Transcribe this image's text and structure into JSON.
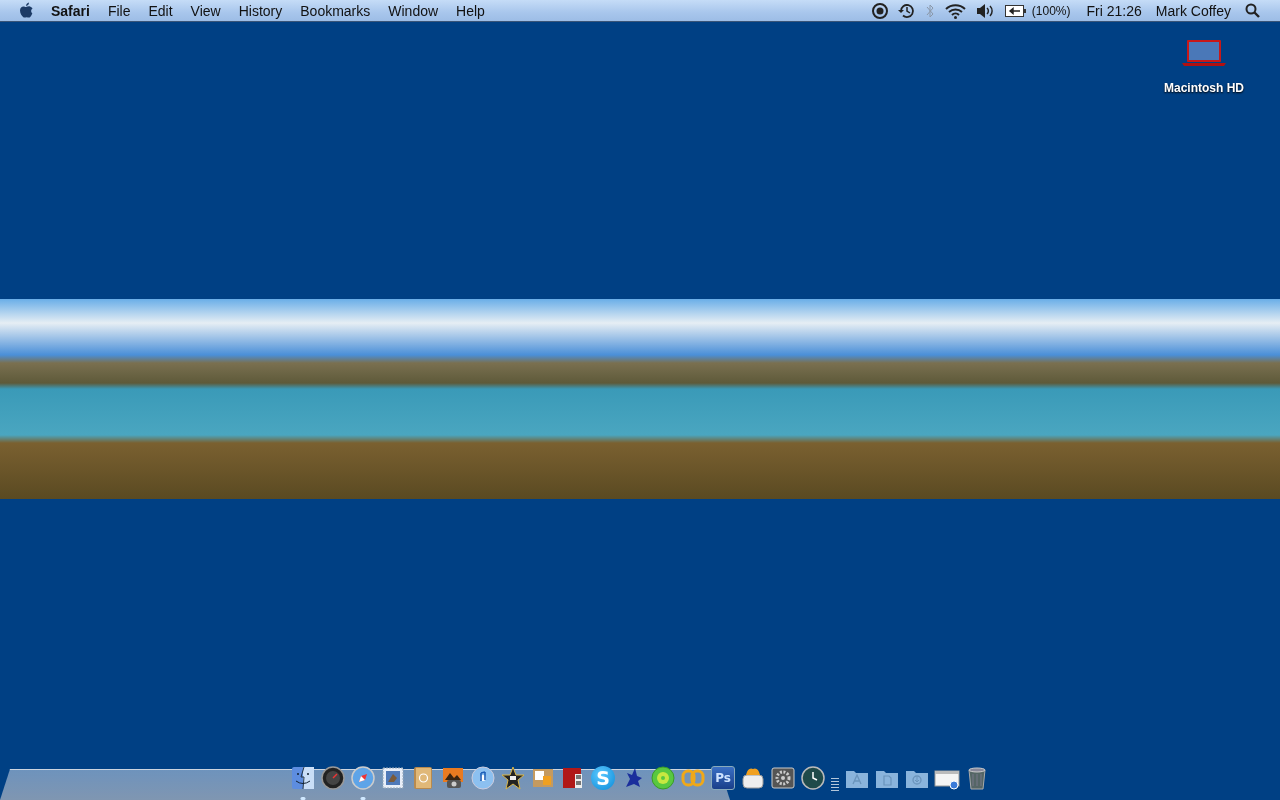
{
  "menu_bar": {
    "app_name": "Safari",
    "menus": [
      "File",
      "Edit",
      "View",
      "History",
      "Bookmarks",
      "Window",
      "Help"
    ],
    "status": [
      {
        "kind": "record"
      },
      {
        "kind": "time-machine"
      },
      {
        "kind": "bluetooth",
        "disabled": true
      },
      {
        "kind": "wifi"
      },
      {
        "kind": "volume"
      },
      {
        "kind": "battery",
        "label": "(100%)"
      }
    ],
    "clock": "Fri 21:26",
    "user": "Mark Coffey"
  },
  "desktop": {
    "icons": [
      {
        "label": "Macintosh HD"
      }
    ]
  },
  "dock": {
    "items": [
      {
        "kind": "finder",
        "running": true
      },
      {
        "kind": "dashboard",
        "running": false
      },
      {
        "kind": "safari",
        "running": true
      },
      {
        "kind": "mail",
        "running": false
      },
      {
        "kind": "addressbook",
        "running": false
      },
      {
        "kind": "iphoto",
        "running": false
      },
      {
        "kind": "itunes",
        "running": false
      },
      {
        "kind": "imovie",
        "running": false
      },
      {
        "kind": "collage",
        "running": false
      },
      {
        "kind": "photobooth",
        "running": false
      },
      {
        "kind": "skype",
        "running": false,
        "label": "S"
      },
      {
        "kind": "creature",
        "running": false
      },
      {
        "kind": "greenball",
        "running": false
      },
      {
        "kind": "rings",
        "running": false
      },
      {
        "kind": "photoshop",
        "running": false,
        "label": "Ps"
      },
      {
        "kind": "toaster",
        "running": false
      },
      {
        "kind": "gear",
        "running": false
      },
      {
        "kind": "timemachine",
        "running": false
      },
      {
        "kind": "separator"
      },
      {
        "kind": "apps-folder",
        "running": false
      },
      {
        "kind": "docs-folder",
        "running": false
      },
      {
        "kind": "downloads-folder",
        "running": false
      },
      {
        "kind": "window",
        "running": false
      },
      {
        "kind": "trash",
        "running": false
      }
    ]
  }
}
